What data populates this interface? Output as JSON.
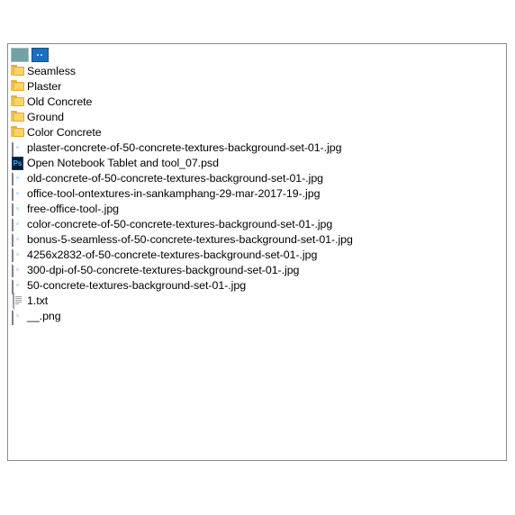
{
  "panel": {
    "name": "file-browser-panel",
    "border_color": "#878c92",
    "background_color": "#ffffff"
  },
  "selection": {
    "highlight_color": "#186fc4",
    "focus_outline": "dotted"
  },
  "files": [
    {
      "label": "..",
      "icon": "parent-folder-icon",
      "type": "parent",
      "selected": true
    },
    {
      "label": "Seamless",
      "icon": "folder-icon",
      "type": "folder",
      "selected": false
    },
    {
      "label": "Plaster",
      "icon": "folder-icon",
      "type": "folder",
      "selected": false
    },
    {
      "label": "Old Concrete",
      "icon": "folder-icon",
      "type": "folder",
      "selected": false
    },
    {
      "label": "Ground",
      "icon": "folder-icon",
      "type": "folder",
      "selected": false
    },
    {
      "label": "Color Concrete",
      "icon": "folder-icon",
      "type": "folder",
      "selected": false
    },
    {
      "label": "plaster-concrete-of-50-concrete-textures-background-set-01-.jpg",
      "icon": "image-file-icon",
      "type": "image",
      "selected": false
    },
    {
      "label": "Open Notebook Tablet  and tool_07.psd",
      "icon": "photoshop-file-icon",
      "type": "psd",
      "selected": false
    },
    {
      "label": "old-concrete-of-50-concrete-textures-background-set-01-.jpg",
      "icon": "image-file-icon",
      "type": "image",
      "selected": false
    },
    {
      "label": "office-tool-ontextures-in-sankamphang-29-mar-2017-19-.jpg",
      "icon": "image-file-icon",
      "type": "image",
      "selected": false
    },
    {
      "label": "free-office-tool-.jpg",
      "icon": "image-file-icon",
      "type": "image",
      "selected": false
    },
    {
      "label": "color-concrete-of-50-concrete-textures-background-set-01-.jpg",
      "icon": "image-file-icon",
      "type": "image",
      "selected": false
    },
    {
      "label": "bonus-5-seamless-of-50-concrete-textures-background-set-01-.jpg",
      "icon": "image-file-icon",
      "type": "image",
      "selected": false
    },
    {
      "label": "4256x2832-of-50-concrete-textures-background-set-01-.jpg",
      "icon": "image-file-icon",
      "type": "image",
      "selected": false
    },
    {
      "label": "300-dpi-of-50-concrete-textures-background-set-01-.jpg",
      "icon": "image-file-icon",
      "type": "image",
      "selected": false
    },
    {
      "label": "50-concrete-textures-background-set-01-.jpg",
      "icon": "image-file-icon",
      "type": "image",
      "selected": false
    },
    {
      "label": "1.txt",
      "icon": "text-file-icon",
      "type": "text",
      "selected": false
    },
    {
      "label": "__.png",
      "icon": "image-file-icon",
      "type": "image",
      "selected": false
    }
  ]
}
